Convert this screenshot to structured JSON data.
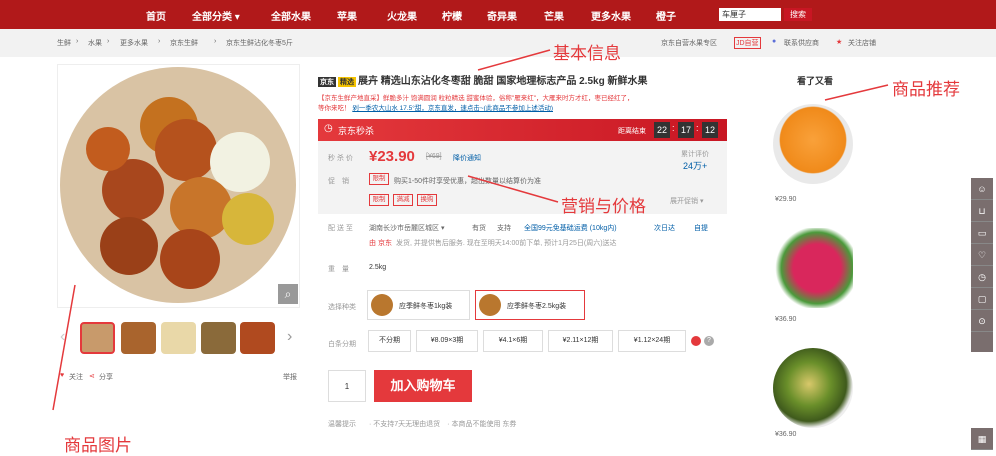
{
  "nav": {
    "items": [
      "首页",
      "全部分类 ▾",
      "全部水果",
      "苹果",
      "火龙果",
      "柠檬",
      "奇异果",
      "芒果",
      "更多水果",
      "橙子"
    ],
    "search_value": "车厘子",
    "search_btn": "搜索"
  },
  "crumb": {
    "items": [
      "生鲜",
      "›",
      "水果",
      "›",
      "更多水果",
      "›",
      "京东生鲜",
      "›",
      "京东生鲜沾化冬枣5斤"
    ],
    "right": [
      "京东自营水果专区",
      "JD自营",
      "联系供应商",
      "关注店铺"
    ]
  },
  "annotations": {
    "basic": "基本信息",
    "recommend": "商品推荐",
    "marketing": "营销与价格",
    "images": "商品图片"
  },
  "product": {
    "tag1": "京东",
    "tag2": "精选",
    "title": "展卉 精选山东沾化冬枣甜 脆甜 国家地理标志产品 2.5kg 新鲜水果",
    "subtitle1": "【京东生鲜产地直采】鲜脆多汁 饱满圆润 粒粒精选 甜蜜体验，俗称\"雁来红\"，大雁来时方才红，枣已经红了，",
    "subtitle2": "等你来吃！",
    "subtitle_link": "剁一季农大山水 17.5°甜，京东直发，速点击~(此商品不参加上述活动)",
    "seckill": "京东秒杀",
    "countdown_label": "距离结束",
    "countdown": [
      "22",
      "17",
      "12"
    ],
    "price_label": "秒 杀 价",
    "price": "¥23.90",
    "orig_price": "[¥69]",
    "notify": "降价通知",
    "review_label": "累计评价",
    "review_count": "24万+",
    "promo_label": "促　销",
    "promo_tag": "限制",
    "promo_text": "购买1-50件时享受优惠，超出数量以结算价为准",
    "promo_more": "展开促销 ▾",
    "promo_tags": [
      "限制",
      "满减",
      "换购"
    ],
    "ship_label": "配 送 至",
    "ship_to": "湖南长沙市岳麓区城区 ▾",
    "stock": "有货",
    "support": "支持",
    "service": "全国99元免基础运费 (10kg内)",
    "arrive": "次日达",
    "pickup": "自提",
    "ship_note_red": "由 京东",
    "ship_note": "发货, 并提供售后服务. 现在至明天14:00前下单, 预计1月25日(周六)送达",
    "weight_label": "重　量",
    "weight": "2.5kg",
    "variant_label": "选择种类",
    "variants": [
      "应季鲜冬枣1kg装",
      "应季鲜冬枣2.5kg装"
    ],
    "install_label": "白条分期",
    "installments": [
      "不分期",
      "¥8.09×3期",
      "¥4.1×6期",
      "¥2.11×12期",
      "¥1.12×24期"
    ],
    "qty": "1",
    "cart_btn": "加入购物车",
    "tip_label": "温馨提示",
    "tips": "· 不支持7天无理由退货　· 本商品不能使用 东券"
  },
  "gallery": {
    "follow": "关注",
    "share": "分享",
    "report": "举报"
  },
  "reco": {
    "title": "看了又看",
    "prices": [
      "¥29.90",
      "¥36.90",
      "¥36.90"
    ]
  },
  "toolbar": {
    "icons": [
      "user-icon",
      "cart-icon",
      "wallet-icon",
      "heart-icon",
      "history-icon",
      "message-icon",
      "help-icon",
      "qrcode-icon"
    ]
  }
}
